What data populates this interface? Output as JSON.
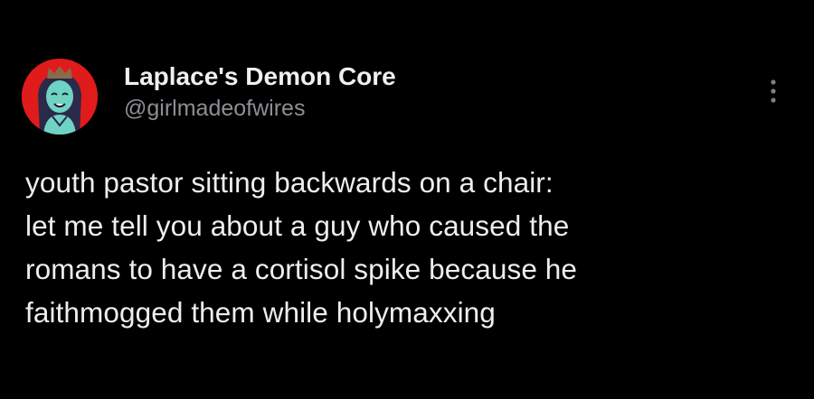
{
  "author": {
    "display_name": "Laplace's Demon Core",
    "handle": "@girlmadeofwires",
    "avatar_icon": "anime-character-avatar",
    "avatar_bg": "#e01b1b"
  },
  "menu": {
    "more_icon": "vertical-ellipsis-icon"
  },
  "tweet": {
    "lines": [
      "youth pastor sitting backwards on a chair:",
      "let me tell you about a guy who caused the",
      "romans to have a cortisol spike because he",
      "faithmogged them while holymaxxing"
    ]
  },
  "colors": {
    "background": "#000000",
    "name": "#f0f0f0",
    "handle": "#8b8f94",
    "text": "#eeeeee"
  }
}
